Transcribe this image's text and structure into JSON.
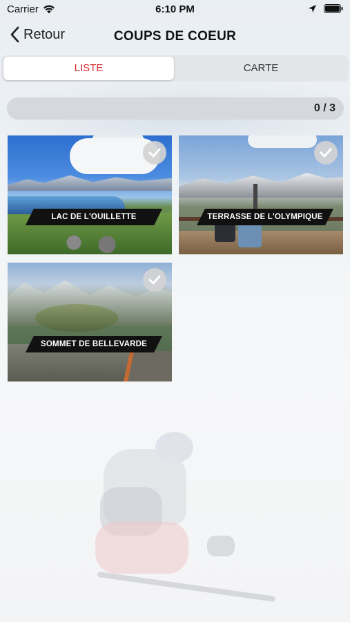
{
  "status_bar": {
    "carrier": "Carrier",
    "time": "6:10 PM",
    "icons": [
      "wifi-icon",
      "location-icon",
      "battery-icon"
    ]
  },
  "nav": {
    "back_label": "Retour",
    "title": "COUPS DE COEUR"
  },
  "segmented_control": {
    "tabs": [
      {
        "label": "LISTE",
        "active": true
      },
      {
        "label": "CARTE",
        "active": false
      }
    ]
  },
  "progress": {
    "label": "0 / 3",
    "done": 0,
    "total": 3
  },
  "cards": [
    {
      "label": "LAC DE L'OUILLETTE",
      "checked": true
    },
    {
      "label": "TERRASSE DE L'OLYMPIQUE",
      "checked": true
    },
    {
      "label": "SOMMET DE BELLEVARDE",
      "checked": true
    }
  ],
  "colors": {
    "accent": "#d9262e",
    "segment_bg": "#e3e5e8",
    "label_bg": "#111111"
  }
}
